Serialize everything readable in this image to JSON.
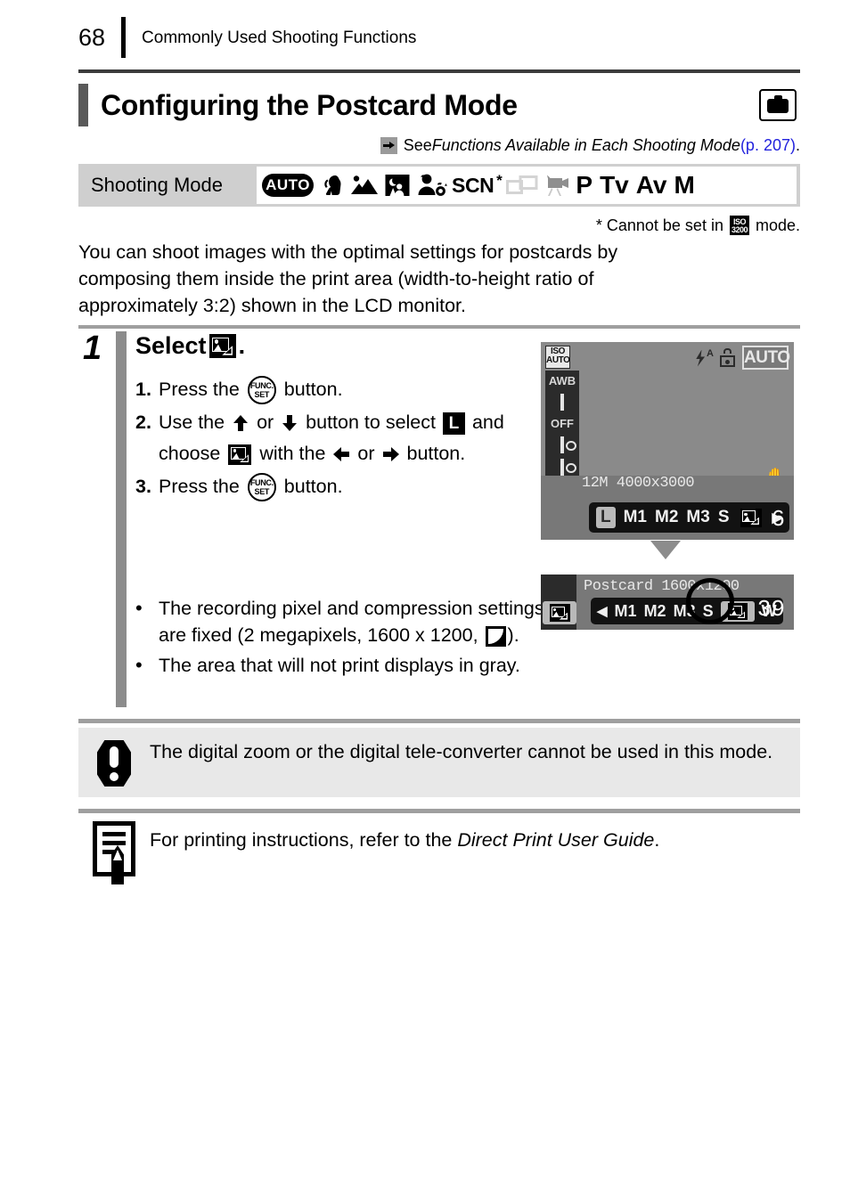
{
  "header": {
    "page_number": "68",
    "chapter": "Commonly Used Shooting Functions"
  },
  "section": {
    "title": "Configuring the Postcard Mode",
    "camera_icon": "camera-icon"
  },
  "see_also": {
    "arrow_icon": "right-arrow-icon",
    "prefix": "See ",
    "reference_italic": "Functions Available in Each Shooting Mode",
    "page_link": " (p. 207)",
    "suffix": "."
  },
  "shooting_mode": {
    "label": "Shooting Mode",
    "icons": [
      {
        "name": "auto-mode-icon",
        "text": "AUTO",
        "style": "pill-black"
      },
      {
        "name": "portrait-mode-icon",
        "text": "",
        "style": "glyph"
      },
      {
        "name": "landscape-mode-icon",
        "text": "",
        "style": "glyph"
      },
      {
        "name": "night-snapshot-mode-icon",
        "text": "",
        "style": "glyph"
      },
      {
        "name": "kids-and-pets-mode-icon",
        "text": "",
        "style": "glyph"
      },
      {
        "name": "scene-mode-icon",
        "text": "SCN",
        "style": "text-star"
      },
      {
        "name": "stitch-assist-mode-icon",
        "text": "",
        "style": "glyph-disabled"
      },
      {
        "name": "movie-mode-icon",
        "text": "",
        "style": "glyph-gray"
      },
      {
        "name": "program-mode-icon",
        "text": "P",
        "style": "text-bold"
      },
      {
        "name": "shutter-priority-mode-icon",
        "text": "Tv",
        "style": "text-bold"
      },
      {
        "name": "aperture-priority-mode-icon",
        "text": "Av",
        "style": "text-bold"
      },
      {
        "name": "manual-mode-icon",
        "text": "M",
        "style": "text-bold"
      }
    ],
    "pasm": [
      "P",
      "Tv",
      "Av",
      "M"
    ]
  },
  "footnote": {
    "prefix": "* Cannot be set in",
    "iso_top": "ISO",
    "iso_bottom": "3200",
    "suffix": "mode."
  },
  "intro": "You can shoot images with the optimal settings for postcards by composing them inside the print area (width-to-height ratio of approximately 3:2) shown in the LCD monitor.",
  "step": {
    "number": "1",
    "heading_prefix": "Select",
    "heading_suffix": ".",
    "postcard_icon": "postcard-mode-icon",
    "substeps": [
      {
        "num": "1.",
        "parts": [
          "Press the",
          "button."
        ],
        "button_icon": "func-set-button-icon",
        "func_top": "FUNC.",
        "func_bottom": "SET"
      },
      {
        "num": "2.",
        "line1_a": "Use the",
        "line1_b": "or",
        "line1_c": "button to select",
        "resolution_badge": "L",
        "line2_a": "and choose",
        "line2_b": "with the",
        "line2_c": "or",
        "line3": "button."
      },
      {
        "num": "3.",
        "parts": [
          "Press the",
          "button."
        ],
        "button_icon": "func-set-button-icon",
        "func_top": "FUNC.",
        "func_bottom": "SET"
      }
    ],
    "bullets": [
      {
        "text_a": "The recording pixel and compression settings are fixed (2 megapixels, 1600 x 1200,",
        "quality_icon": "fine-quality-icon",
        "text_b": ")."
      },
      {
        "text_a": "The area that will not print displays in gray.",
        "quality_icon": "",
        "text_b": ""
      }
    ]
  },
  "lcd_before": {
    "iso_top": "ISO",
    "iso_bottom": "AUTO",
    "sidebar": [
      {
        "name": "white-balance-icon",
        "text": "AWB"
      },
      {
        "name": "frame-icon",
        "text": ""
      },
      {
        "name": "drive-mode-off-icon",
        "text": "OFF"
      },
      {
        "name": "flash-exposure-icon",
        "text": ""
      },
      {
        "name": "metering-mode-icon",
        "text": ""
      },
      {
        "name": "compression-icon",
        "text": ""
      }
    ],
    "selected_resolution": "L",
    "flash_icon": "flash-auto-icon",
    "redeye_icon": "red-eye-reduction-icon",
    "mode_badge": "AUTO",
    "shake_icon": "camera-shake-warning-icon",
    "info_line": "12M 4000x3000",
    "menu_items": [
      "L",
      "M1",
      "M2",
      "M3",
      "S"
    ],
    "menu_selected": "L",
    "postcard_item_icon": "postcard-mode-icon",
    "next_arrow": "▶",
    "shots_remaining": "6"
  },
  "lcd_after": {
    "left_icon": "postcard-mode-icon",
    "info_line": "Postcard 1600x1200",
    "prev_arrow": "◀",
    "menu_items": [
      "M1",
      "M2",
      "M3",
      "S"
    ],
    "postcard_item_icon": "postcard-mode-icon",
    "widescreen_item": "W",
    "shots_remaining": "39"
  },
  "warning": {
    "icon": "exclamation-icon",
    "text": "The digital zoom or the digital tele-converter cannot be used in this mode."
  },
  "note": {
    "icon": "note-pencil-icon",
    "text_prefix": "For printing instructions, refer to the ",
    "text_italic": "Direct Print User Guide",
    "text_suffix": "."
  }
}
